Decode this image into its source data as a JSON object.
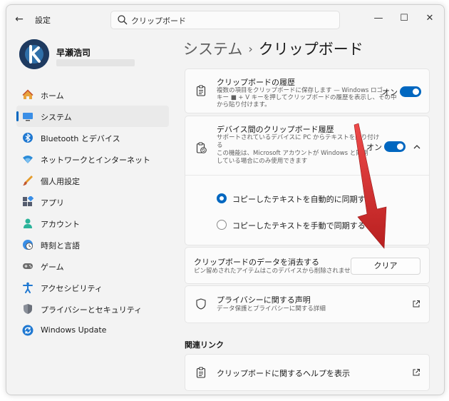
{
  "window": {
    "app_title": "設定",
    "search_value": "クリップボード",
    "controls": {
      "minimize": "—",
      "maximize": "☐",
      "close": "✕"
    }
  },
  "profile": {
    "name": "早瀬浩司"
  },
  "nav": {
    "items": [
      {
        "label": "ホーム",
        "icon": "home-icon"
      },
      {
        "label": "システム",
        "icon": "system-icon",
        "active": true
      },
      {
        "label": "Bluetooth とデバイス",
        "icon": "bluetooth-icon"
      },
      {
        "label": "ネットワークとインターネット",
        "icon": "wifi-icon"
      },
      {
        "label": "個人用設定",
        "icon": "brush-icon"
      },
      {
        "label": "アプリ",
        "icon": "apps-icon"
      },
      {
        "label": "アカウント",
        "icon": "account-icon"
      },
      {
        "label": "時刻と言語",
        "icon": "clock-globe-icon"
      },
      {
        "label": "ゲーム",
        "icon": "gamepad-icon"
      },
      {
        "label": "アクセシビリティ",
        "icon": "accessibility-icon"
      },
      {
        "label": "プライバシーとセキュリティ",
        "icon": "shield-icon"
      },
      {
        "label": "Windows Update",
        "icon": "update-icon"
      }
    ]
  },
  "breadcrumb": {
    "parent": "システム",
    "separator": "›",
    "current": "クリップボード"
  },
  "history": {
    "title": "クリップボードの履歴",
    "desc1": "複数の項目をクリップボードに保存します — Windows ロゴ",
    "desc2": "キー ■ + V キーを押してクリップボードの履歴を表示し、その中",
    "desc3": "から貼り付けます。",
    "state": "オン"
  },
  "sync": {
    "title": "デバイス間のクリップボード履歴",
    "desc1": "サポートされているデバイスに PC からテキストを貼り付け",
    "desc2": "る",
    "desc3": "この機能は、Microsoft アカウントが Windows と同期",
    "desc4": "している場合にのみ使用できます",
    "state": "オン",
    "option_auto": "コピーしたテキストを自動的に同期する",
    "option_manual": "コピーしたテキストを手動で同期する"
  },
  "clear": {
    "title": "クリップボードのデータを消去する",
    "desc": "ピン留めされたアイテムはこのデバイスから削除されません",
    "button": "クリア"
  },
  "privacy": {
    "title": "プライバシーに関する声明",
    "desc": "データ保護とプライバシーに関する詳細"
  },
  "related": {
    "label": "関連リンク",
    "help": "クリップボードに関するヘルプを表示"
  },
  "colors": {
    "accent": "#0067c0",
    "annotation_arrow": "#d62a2a"
  }
}
